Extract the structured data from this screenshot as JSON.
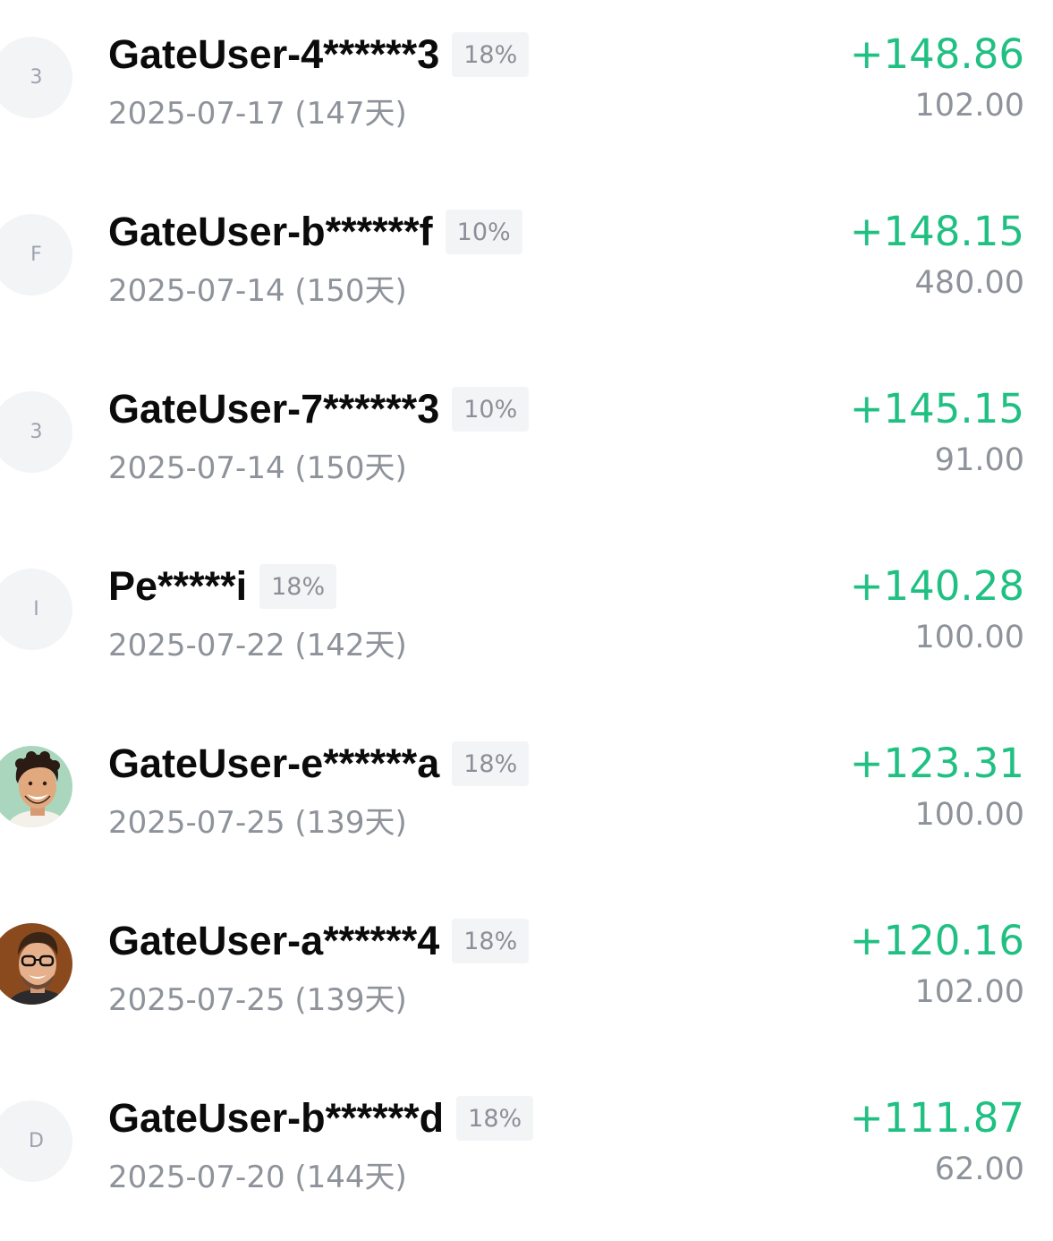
{
  "rows": [
    {
      "avatar_letter": "3",
      "avatar_image": "",
      "name": "GateUser-4******3",
      "badge": "18%",
      "date": "2025-07-17 (147天)",
      "profit": "+148.86",
      "amount": "102.00"
    },
    {
      "avatar_letter": "F",
      "avatar_image": "",
      "name": "GateUser-b******f",
      "badge": "10%",
      "date": "2025-07-14 (150天)",
      "profit": "+148.15",
      "amount": "480.00"
    },
    {
      "avatar_letter": "3",
      "avatar_image": "",
      "name": "GateUser-7******3",
      "badge": "10%",
      "date": "2025-07-14 (150天)",
      "profit": "+145.15",
      "amount": "91.00"
    },
    {
      "avatar_letter": "I",
      "avatar_image": "",
      "name": "Pe*****i",
      "badge": "18%",
      "date": "2025-07-22 (142天)",
      "profit": "+140.28",
      "amount": "100.00"
    },
    {
      "avatar_letter": "",
      "avatar_image": "smiling-man-photo-green",
      "name": "GateUser-e******a",
      "badge": "18%",
      "date": "2025-07-25 (139天)",
      "profit": "+123.31",
      "amount": "100.00"
    },
    {
      "avatar_letter": "",
      "avatar_image": "smiling-man-glasses-photo-brown",
      "name": "GateUser-a******4",
      "badge": "18%",
      "date": "2025-07-25 (139天)",
      "profit": "+120.16",
      "amount": "102.00"
    },
    {
      "avatar_letter": "D",
      "avatar_image": "",
      "name": "GateUser-b******d",
      "badge": "18%",
      "date": "2025-07-20 (144天)",
      "profit": "+111.87",
      "amount": "62.00"
    }
  ],
  "colors": {
    "profit_green": "#20c083",
    "secondary_gray": "#8e929a",
    "badge_bg": "#f3f4f6",
    "name_black": "#0b0b0b"
  }
}
